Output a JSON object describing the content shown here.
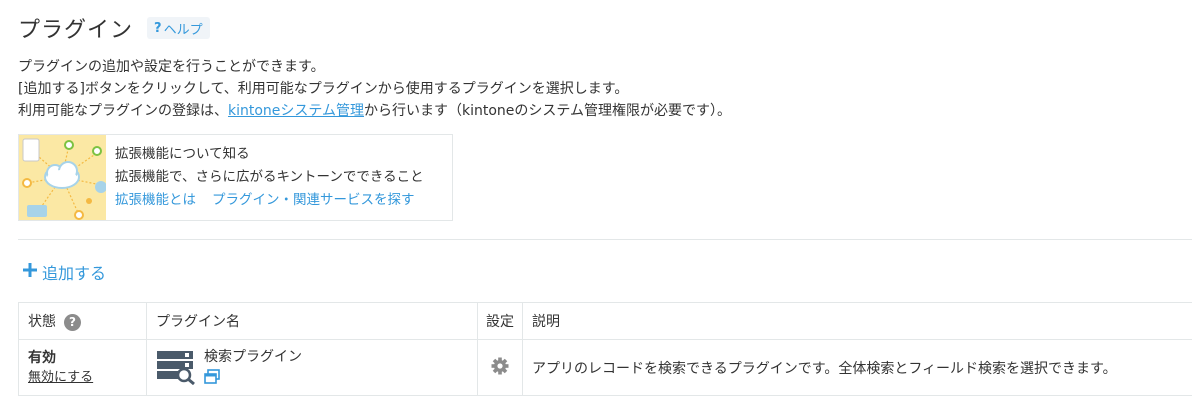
{
  "header": {
    "title": "プラグイン",
    "help_q": "?",
    "help_label": "ヘルプ"
  },
  "description": {
    "line1": "プラグインの追加や設定を行うことができます。",
    "line2": "[追加する]ボタンをクリックして、利用可能なプラグインから使用するプラグインを選択します。",
    "line3_before": "利用可能なプラグインの登録は、",
    "line3_link": "kintoneシステム管理",
    "line3_after": "から行います（kintoneのシステム管理権限が必要です）。"
  },
  "promo": {
    "title": "拡張機能について知る",
    "subtitle": "拡張機能で、さらに広がるキントーンでできること",
    "link1": "拡張機能とは",
    "link2": "プラグイン・関連サービスを探す"
  },
  "add_button": {
    "icon": "plus-icon",
    "label": "追加する"
  },
  "table": {
    "headers": {
      "status": "状態",
      "status_help": "?",
      "name": "プラグイン名",
      "setting": "設定",
      "description": "説明"
    },
    "rows": [
      {
        "status": "有効",
        "toggle_link": "無効にする",
        "name": "検索プラグイン",
        "description": "アプリのレコードを検索できるプラグインです。全体検索とフィールド検索を選択できます。"
      }
    ]
  },
  "colors": {
    "link": "#3498db",
    "border": "#e3e7e8",
    "promo_bg": "#fbe8a4"
  }
}
